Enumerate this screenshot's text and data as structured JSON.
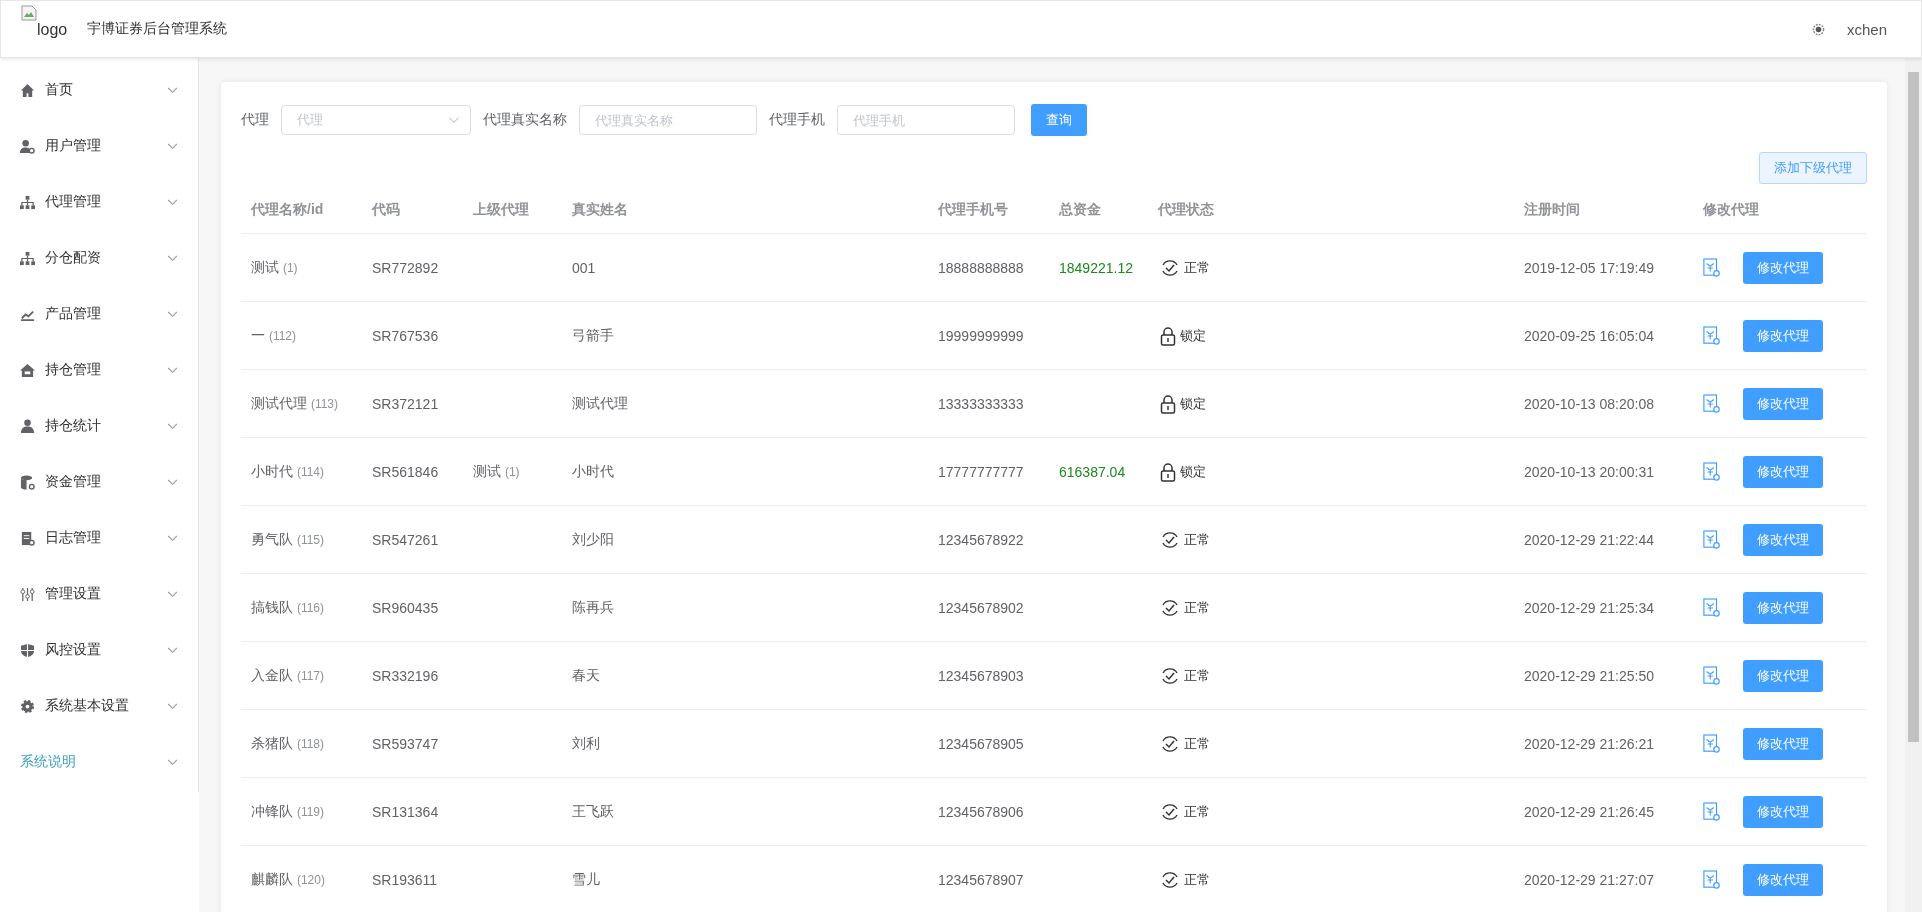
{
  "header": {
    "logo_alt": "logo",
    "title": "宇博证券后台管理系统",
    "user": "xchen"
  },
  "sidebar": {
    "items": [
      {
        "label": "首页",
        "kind": "home",
        "selected": false
      },
      {
        "label": "用户管理",
        "kind": "user",
        "selected": false
      },
      {
        "label": "代理管理",
        "kind": "tree",
        "selected": false
      },
      {
        "label": "分仓配资",
        "kind": "tree",
        "selected": false
      },
      {
        "label": "产品管理",
        "kind": "chart",
        "selected": false
      },
      {
        "label": "持仓管理",
        "kind": "house",
        "selected": false
      },
      {
        "label": "持仓统计",
        "kind": "people",
        "selected": false
      },
      {
        "label": "资金管理",
        "kind": "database",
        "selected": false
      },
      {
        "label": "日志管理",
        "kind": "doc",
        "selected": false
      },
      {
        "label": "管理设置",
        "kind": "sliders",
        "selected": false
      },
      {
        "label": "风控设置",
        "kind": "shield",
        "selected": false
      },
      {
        "label": "系统基本设置",
        "kind": "gear",
        "selected": false
      },
      {
        "label": "系统说明",
        "kind": "plain",
        "selected": true
      }
    ]
  },
  "filters": {
    "agent": {
      "label": "代理",
      "placeholder": "代理"
    },
    "real_name": {
      "label": "代理真实名称",
      "placeholder": "代理真实名称"
    },
    "phone": {
      "label": "代理手机",
      "placeholder": "代理手机"
    },
    "search_button": "查询",
    "add_button": "添加下级代理"
  },
  "table": {
    "columns": [
      "代理名称/id",
      "代码",
      "上级代理",
      "真实姓名",
      "代理手机号",
      "总资金",
      "代理状态",
      "注册时间",
      "修改代理"
    ],
    "rows": [
      {
        "name": "测试",
        "id": "(1)",
        "code": "SR772892",
        "parent": "",
        "parent_id": "",
        "real_name": "001",
        "phone": "18888888888",
        "fund": "1849221.12",
        "status": {
          "kind": "normal",
          "label": "正常"
        },
        "registered": "2019-12-05 17:19:49",
        "action": "修改代理"
      },
      {
        "name": "一",
        "id": "(112)",
        "code": "SR767536",
        "parent": "",
        "parent_id": "",
        "real_name": "弓箭手",
        "phone": "19999999999",
        "fund": "",
        "status": {
          "kind": "locked",
          "label": "锁定"
        },
        "registered": "2020-09-25 16:05:04",
        "action": "修改代理"
      },
      {
        "name": "测试代理",
        "id": "(113)",
        "code": "SR372121",
        "parent": "",
        "parent_id": "",
        "real_name": "测试代理",
        "phone": "13333333333",
        "fund": "",
        "status": {
          "kind": "locked",
          "label": "锁定"
        },
        "registered": "2020-10-13 08:20:08",
        "action": "修改代理"
      },
      {
        "name": "小时代",
        "id": "(114)",
        "code": "SR561846",
        "parent": "测试",
        "parent_id": "(1)",
        "real_name": "小时代",
        "phone": "17777777777",
        "fund": "616387.04",
        "status": {
          "kind": "locked",
          "label": "锁定"
        },
        "registered": "2020-10-13 20:00:31",
        "action": "修改代理"
      },
      {
        "name": "勇气队",
        "id": "(115)",
        "code": "SR547261",
        "parent": "",
        "parent_id": "",
        "real_name": "刘少阳",
        "phone": "12345678922",
        "fund": "",
        "status": {
          "kind": "normal",
          "label": "正常"
        },
        "registered": "2020-12-29 21:22:44",
        "action": "修改代理"
      },
      {
        "name": "搞钱队",
        "id": "(116)",
        "code": "SR960435",
        "parent": "",
        "parent_id": "",
        "real_name": "陈再兵",
        "phone": "12345678902",
        "fund": "",
        "status": {
          "kind": "normal",
          "label": "正常"
        },
        "registered": "2020-12-29 21:25:34",
        "action": "修改代理"
      },
      {
        "name": "入金队",
        "id": "(117)",
        "code": "SR332196",
        "parent": "",
        "parent_id": "",
        "real_name": "春天",
        "phone": "12345678903",
        "fund": "",
        "status": {
          "kind": "normal",
          "label": "正常"
        },
        "registered": "2020-12-29 21:25:50",
        "action": "修改代理"
      },
      {
        "name": "杀猪队",
        "id": "(118)",
        "code": "SR593747",
        "parent": "",
        "parent_id": "",
        "real_name": "刘利",
        "phone": "12345678905",
        "fund": "",
        "status": {
          "kind": "normal",
          "label": "正常"
        },
        "registered": "2020-12-29 21:26:21",
        "action": "修改代理"
      },
      {
        "name": "冲锋队",
        "id": "(119)",
        "code": "SR131364",
        "parent": "",
        "parent_id": "",
        "real_name": "王飞跃",
        "phone": "12345678906",
        "fund": "",
        "status": {
          "kind": "normal",
          "label": "正常"
        },
        "registered": "2020-12-29 21:26:45",
        "action": "修改代理"
      },
      {
        "name": "麒麟队",
        "id": "(120)",
        "code": "SR193611",
        "parent": "",
        "parent_id": "",
        "real_name": "雪儿",
        "phone": "12345678907",
        "fund": "",
        "status": {
          "kind": "normal",
          "label": "正常"
        },
        "registered": "2020-12-29 21:27:07",
        "action": "修改代理"
      }
    ]
  }
}
